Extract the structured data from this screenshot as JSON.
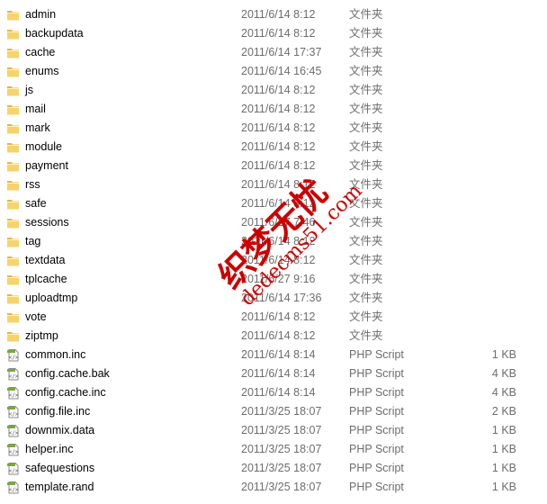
{
  "files": [
    {
      "name": "admin",
      "date": "2011/6/14 8:12",
      "type": "文件夹",
      "size": "",
      "icon": "folder"
    },
    {
      "name": "backupdata",
      "date": "2011/6/14 8:12",
      "type": "文件夹",
      "size": "",
      "icon": "folder"
    },
    {
      "name": "cache",
      "date": "2011/6/14 17:37",
      "type": "文件夹",
      "size": "",
      "icon": "folder"
    },
    {
      "name": "enums",
      "date": "2011/6/14 16:45",
      "type": "文件夹",
      "size": "",
      "icon": "folder"
    },
    {
      "name": "js",
      "date": "2011/6/14 8:12",
      "type": "文件夹",
      "size": "",
      "icon": "folder"
    },
    {
      "name": "mail",
      "date": "2011/6/14 8:12",
      "type": "文件夹",
      "size": "",
      "icon": "folder"
    },
    {
      "name": "mark",
      "date": "2011/6/14 8:12",
      "type": "文件夹",
      "size": "",
      "icon": "folder"
    },
    {
      "name": "module",
      "date": "2011/6/14 8:12",
      "type": "文件夹",
      "size": "",
      "icon": "folder"
    },
    {
      "name": "payment",
      "date": "2011/6/14 8:12",
      "type": "文件夹",
      "size": "",
      "icon": "folder"
    },
    {
      "name": "rss",
      "date": "2011/6/14 8:12",
      "type": "文件夹",
      "size": "",
      "icon": "folder"
    },
    {
      "name": "safe",
      "date": "2011/6/14 8:12",
      "type": "文件夹",
      "size": "",
      "icon": "folder"
    },
    {
      "name": "sessions",
      "date": "2011/6/27 7:46",
      "type": "文件夹",
      "size": "",
      "icon": "folder"
    },
    {
      "name": "tag",
      "date": "2011/6/14 8:12",
      "type": "文件夹",
      "size": "",
      "icon": "folder"
    },
    {
      "name": "textdata",
      "date": "2011/6/14 8:12",
      "type": "文件夹",
      "size": "",
      "icon": "folder"
    },
    {
      "name": "tplcache",
      "date": "2011/6/27 9:16",
      "type": "文件夹",
      "size": "",
      "icon": "folder"
    },
    {
      "name": "uploadtmp",
      "date": "2011/6/14 17:36",
      "type": "文件夹",
      "size": "",
      "icon": "folder"
    },
    {
      "name": "vote",
      "date": "2011/6/14 8:12",
      "type": "文件夹",
      "size": "",
      "icon": "folder"
    },
    {
      "name": "ziptmp",
      "date": "2011/6/14 8:12",
      "type": "文件夹",
      "size": "",
      "icon": "folder"
    },
    {
      "name": "common.inc",
      "date": "2011/6/14 8:14",
      "type": "PHP Script",
      "size": "1 KB",
      "icon": "php"
    },
    {
      "name": "config.cache.bak",
      "date": "2011/6/14 8:14",
      "type": "PHP Script",
      "size": "4 KB",
      "icon": "php"
    },
    {
      "name": "config.cache.inc",
      "date": "2011/6/14 8:14",
      "type": "PHP Script",
      "size": "4 KB",
      "icon": "php"
    },
    {
      "name": "config.file.inc",
      "date": "2011/3/25 18:07",
      "type": "PHP Script",
      "size": "2 KB",
      "icon": "php"
    },
    {
      "name": "downmix.data",
      "date": "2011/3/25 18:07",
      "type": "PHP Script",
      "size": "1 KB",
      "icon": "php"
    },
    {
      "name": "helper.inc",
      "date": "2011/3/25 18:07",
      "type": "PHP Script",
      "size": "1 KB",
      "icon": "php"
    },
    {
      "name": "safequestions",
      "date": "2011/3/25 18:07",
      "type": "PHP Script",
      "size": "1 KB",
      "icon": "php"
    },
    {
      "name": "template.rand",
      "date": "2011/3/25 18:07",
      "type": "PHP Script",
      "size": "1 KB",
      "icon": "php"
    }
  ],
  "watermark": {
    "line1": "织梦无忧",
    "line2": "dedecms51.com",
    "color": "#cc0000"
  }
}
